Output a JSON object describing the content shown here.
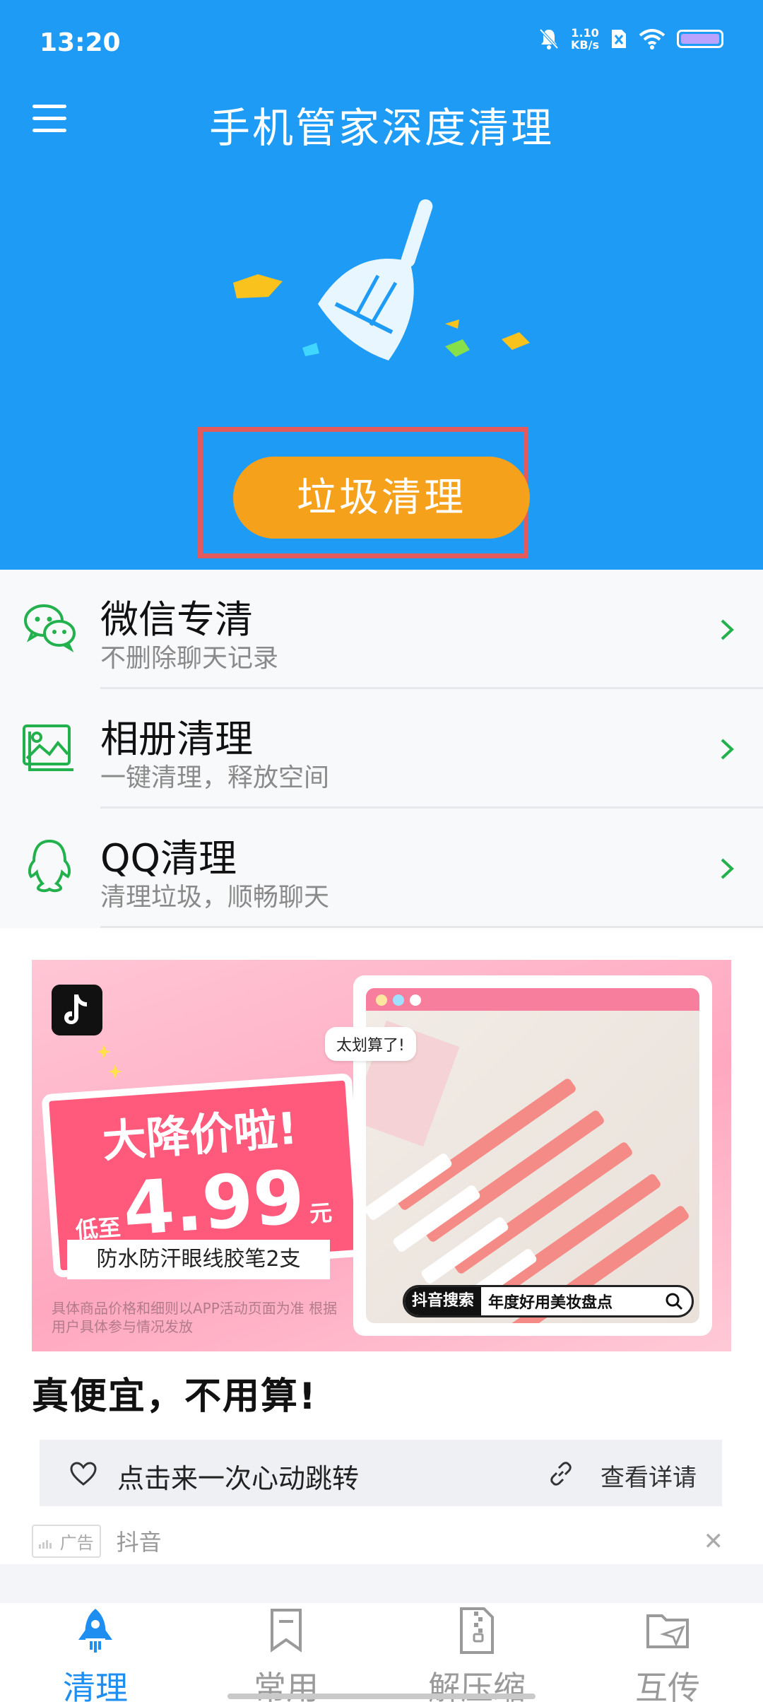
{
  "status_bar": {
    "time": "13:20",
    "net_speed_value": "1.10",
    "net_speed_unit": "KB/s",
    "icons": [
      "mute-icon",
      "sim-x-icon",
      "wifi-icon",
      "battery-icon"
    ]
  },
  "header": {
    "menu_icon": "hamburger-menu-icon",
    "title": "手机管家深度清理",
    "primary_button": "垃圾清理"
  },
  "features": [
    {
      "name": "微信专清",
      "desc": "不删除聊天记录",
      "icon": "wechat-icon"
    },
    {
      "name": "相册清理",
      "desc": "一键清理，释放空间",
      "icon": "photo-album-icon"
    },
    {
      "name": "QQ清理",
      "desc": "清理垃圾，顺畅聊天",
      "icon": "qq-icon"
    }
  ],
  "ad": {
    "promo_headline": "大降价啦!",
    "promo_prefix": "低至",
    "promo_price": "4.99",
    "promo_unit": "元",
    "promo_subtitle": "防水防汗眼线胶笔2支",
    "disclaimer": "具体商品价格和细则以APP活动页面为准 根据用户具体参与情况发放",
    "speech_bubble": "太划算了!",
    "search_tag": "抖音搜索",
    "search_text": "年度好用美妆盘点",
    "title": "真便宜，不用算!",
    "cta_label": "点击来一次心动跳转",
    "cta_detail": "查看详请",
    "badge": "广告",
    "source": "抖音"
  },
  "bottom_nav": [
    {
      "label": "清理",
      "icon": "rocket-icon",
      "active": true
    },
    {
      "label": "常用",
      "icon": "bookmark-icon",
      "active": false
    },
    {
      "label": "解压缩",
      "icon": "zip-file-icon",
      "active": false
    },
    {
      "label": "互传",
      "icon": "folder-send-icon",
      "active": false
    }
  ],
  "colors": {
    "header_bg": "#1e9bf4",
    "primary_button": "#f6a11b",
    "highlight_frame": "#e25a5c",
    "feature_icon": "#22b14c",
    "nav_active": "#1e8ff0"
  }
}
